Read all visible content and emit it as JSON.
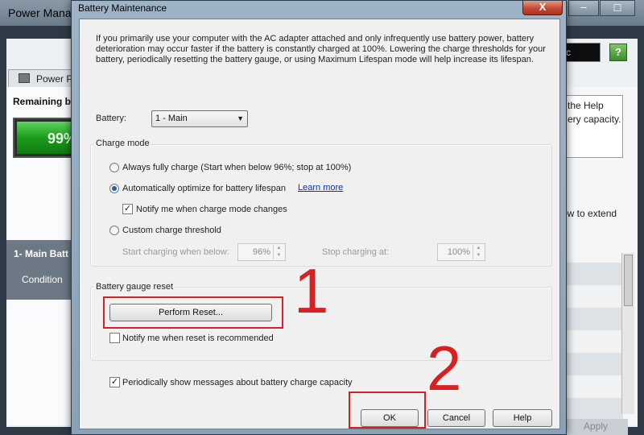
{
  "background_window": {
    "title": "Power Mana",
    "minimize_glyph": "–",
    "maximize_glyph": "☐",
    "tab_label": "Power P",
    "remaining_label": "Remaining b",
    "battery_percent": "99%",
    "section_title": "1- Main Batt",
    "section_sub": "Condition",
    "search_text": "c",
    "help_glyph": "?",
    "help_text_line1": "the Help",
    "help_text_line2": "ery capacity.",
    "extend_text": "ow to extend",
    "apply_label": "Apply"
  },
  "dialog": {
    "title": "Battery Maintenance",
    "close_glyph": "X",
    "intro_text": "If you primarily use your computer with the AC adapter attached and only infrequently use battery power, battery deterioration may occur faster if the battery is constantly charged at 100%. Lowering the charge thresholds for your battery, periodically resetting the battery gauge, or using Maximum Lifespan mode will help increase its lifespan.",
    "battery_label": "Battery:",
    "battery_selected": "1 - Main",
    "charge_mode": {
      "group_label": "Charge mode",
      "always_full": "Always fully charge (Start when below 96%; stop at 100%)",
      "auto_optimize": "Automatically optimize for battery lifespan",
      "learn_more": "Learn more",
      "notify_changes": "Notify me when charge mode changes",
      "custom_threshold": "Custom charge threshold",
      "start_label": "Start charging when below:",
      "start_value": "96%",
      "stop_label": "Stop charging at:",
      "stop_value": "100%"
    },
    "gauge_reset": {
      "group_label": "Battery gauge reset",
      "perform_reset": "Perform Reset...",
      "notify_reset": "Notify me when reset is recommended"
    },
    "periodic_messages": "Periodically show messages about battery charge capacity",
    "buttons": {
      "ok": "OK",
      "cancel": "Cancel",
      "help": "Help"
    },
    "checked_mark": "✓"
  },
  "annotations": {
    "step1": "1",
    "step2": "2",
    "color": "#d82020"
  }
}
